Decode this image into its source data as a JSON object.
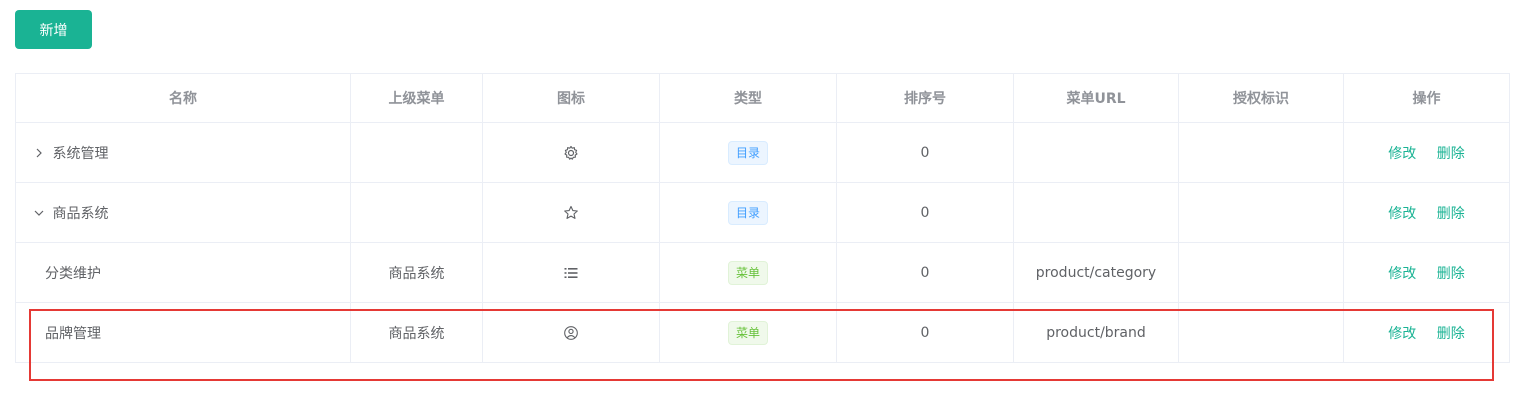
{
  "toolbar": {
    "add_label": "新增"
  },
  "table": {
    "headers": [
      "名称",
      "上级菜单",
      "图标",
      "类型",
      "排序号",
      "菜单URL",
      "授权标识",
      "操作"
    ],
    "rows": [
      {
        "expand": "collapsed",
        "name": "系统管理",
        "parent": "",
        "icon": "gear-icon",
        "type": "目录",
        "type_kind": "dir",
        "order": "0",
        "url": "",
        "perms": "",
        "edit": "修改",
        "delete": "删除"
      },
      {
        "expand": "expanded",
        "name": "商品系统",
        "parent": "",
        "icon": "star-icon",
        "type": "目录",
        "type_kind": "dir",
        "order": "0",
        "url": "",
        "perms": "",
        "edit": "修改",
        "delete": "删除"
      },
      {
        "expand": "none",
        "name": "分类维护",
        "parent": "商品系统",
        "icon": "list-icon",
        "type": "菜单",
        "type_kind": "menu",
        "order": "0",
        "url": "product/category",
        "perms": "",
        "edit": "修改",
        "delete": "删除"
      },
      {
        "expand": "none",
        "name": "品牌管理",
        "parent": "商品系统",
        "icon": "user-circle-icon",
        "type": "菜单",
        "type_kind": "menu",
        "order": "0",
        "url": "product/brand",
        "perms": "",
        "edit": "修改",
        "delete": "删除"
      }
    ]
  },
  "colors": {
    "primary": "#1ab394",
    "tag_dir": "#409eff",
    "tag_menu": "#67c23a",
    "highlight": "#e53935"
  }
}
